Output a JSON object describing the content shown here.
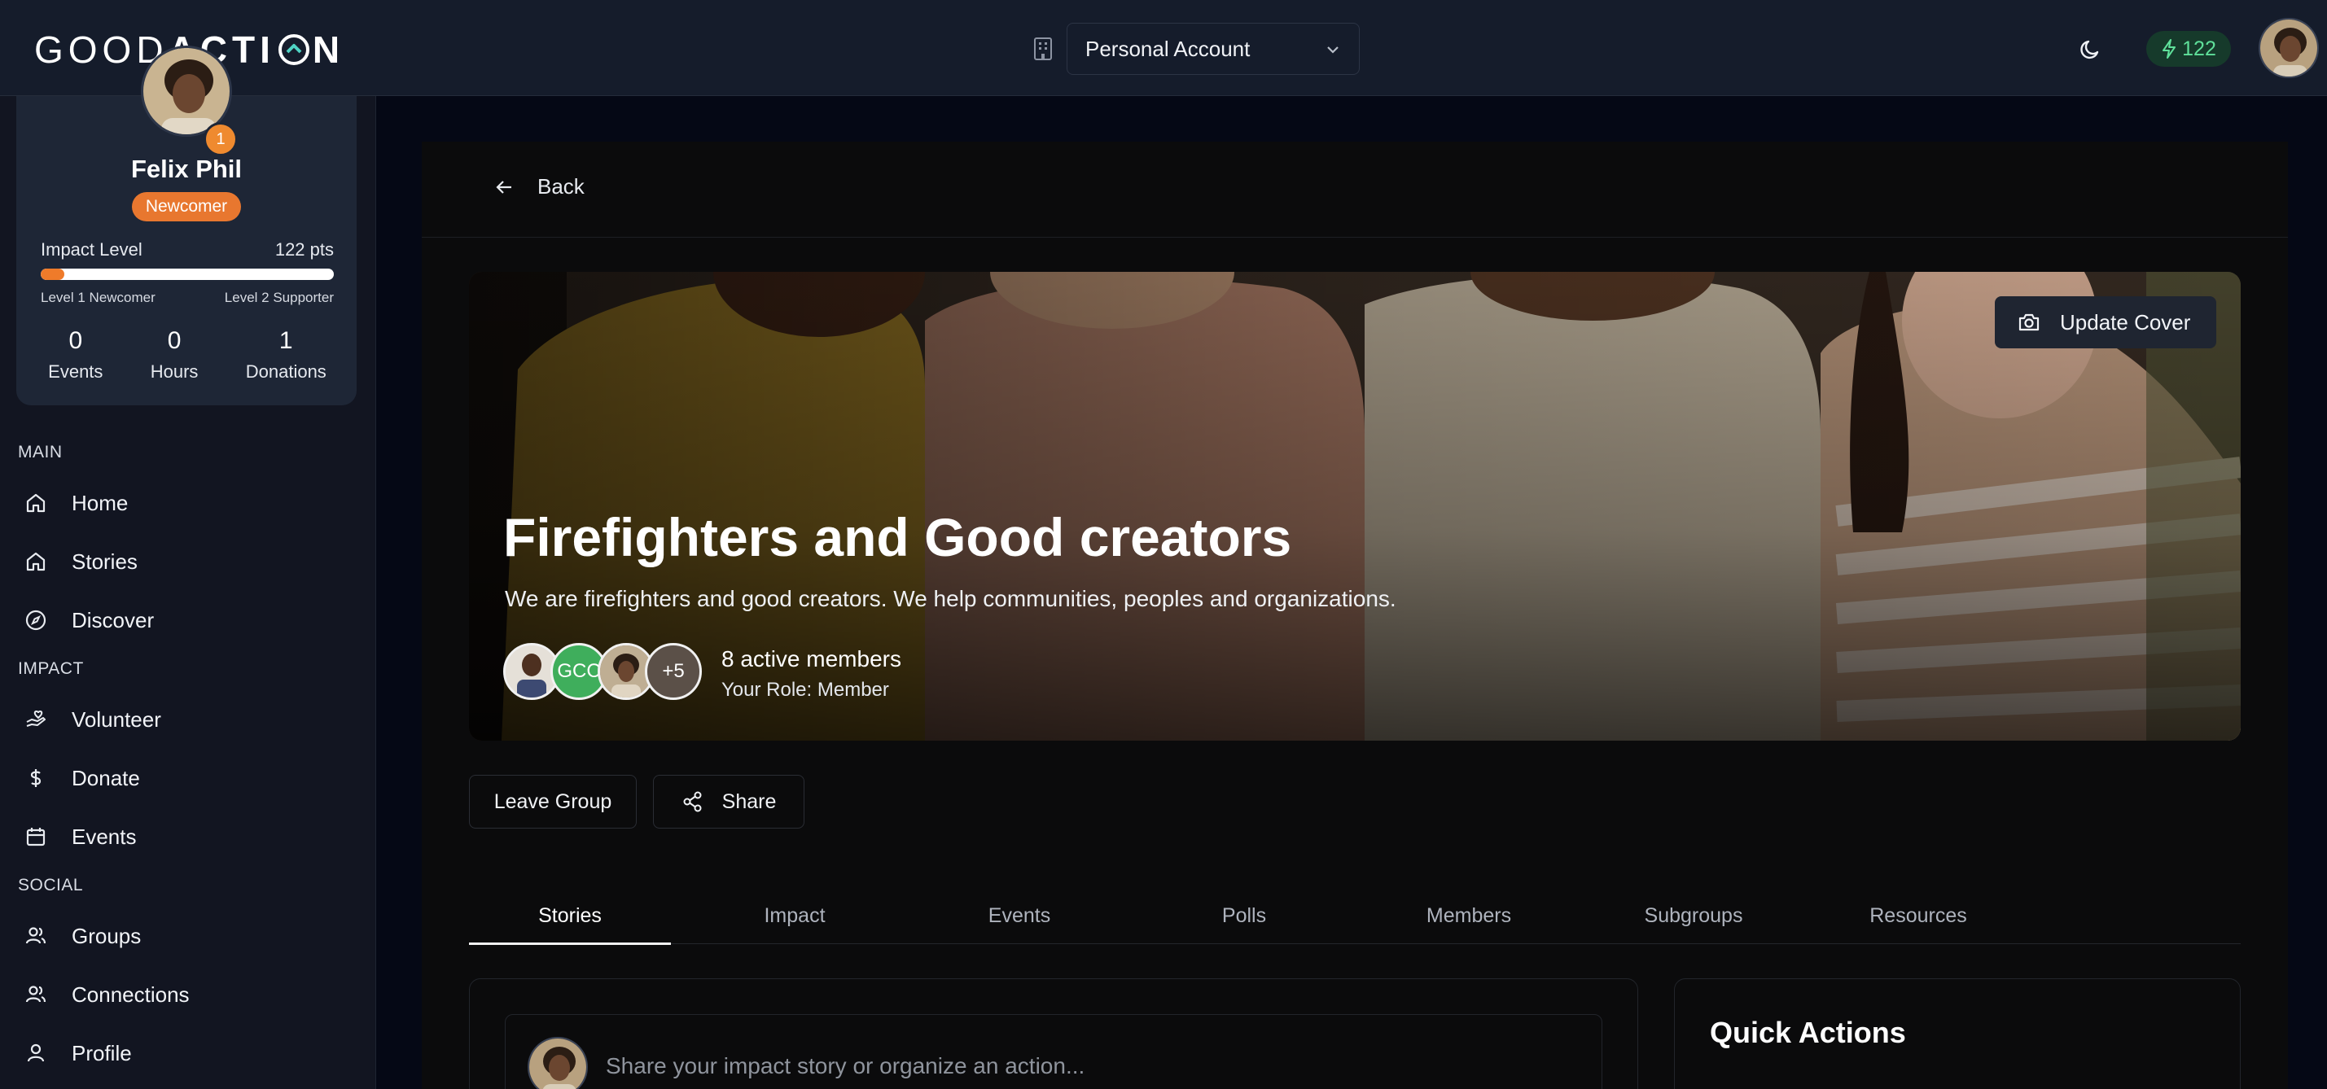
{
  "app": {
    "logo_text_light": "GOOD",
    "logo_text_bold": "ACTI",
    "logo_text_end": "N"
  },
  "header": {
    "account_select": "Personal Account",
    "points": "122",
    "accent_green": "#5fe09a"
  },
  "profile": {
    "name": "Felix Phil",
    "notification_count": "1",
    "rank_badge": "Newcomer",
    "impact_label": "Impact Level",
    "impact_points": "122 pts",
    "impact_progress": 0.08,
    "level_current": "Level 1 Newcomer",
    "level_next": "Level 2 Supporter",
    "stats": [
      {
        "value": "0",
        "label": "Events"
      },
      {
        "value": "0",
        "label": "Hours"
      },
      {
        "value": "1",
        "label": "Donations"
      }
    ]
  },
  "sidebar": {
    "sections": [
      {
        "title": "MAIN",
        "items": [
          {
            "label": "Home",
            "icon": "home-icon"
          },
          {
            "label": "Stories",
            "icon": "home-icon"
          },
          {
            "label": "Discover",
            "icon": "compass-icon"
          }
        ]
      },
      {
        "title": "IMPACT",
        "items": [
          {
            "label": "Volunteer",
            "icon": "hand-heart-icon"
          },
          {
            "label": "Donate",
            "icon": "dollar-icon"
          },
          {
            "label": "Events",
            "icon": "calendar-icon"
          }
        ]
      },
      {
        "title": "SOCIAL",
        "items": [
          {
            "label": "Groups",
            "icon": "users-icon"
          },
          {
            "label": "Connections",
            "icon": "users-icon"
          },
          {
            "label": "Profile",
            "icon": "user-icon"
          }
        ]
      }
    ]
  },
  "group": {
    "back_label": "Back",
    "update_cover_label": "Update Cover",
    "title": "Firefighters and Good creators",
    "description": "We are firefighters and good creators. We help communities, peoples and organizations.",
    "avatar_initials": "GCC",
    "more_members": "+5",
    "members_count": "8 active members",
    "role": "Your Role: Member",
    "leave_label": "Leave Group",
    "share_label": "Share"
  },
  "tabs": [
    "Stories",
    "Impact",
    "Events",
    "Polls",
    "Members",
    "Subgroups",
    "Resources"
  ],
  "composer": {
    "placeholder": "Share your impact story or organize an action..."
  },
  "quick_actions": {
    "title": "Quick Actions"
  }
}
